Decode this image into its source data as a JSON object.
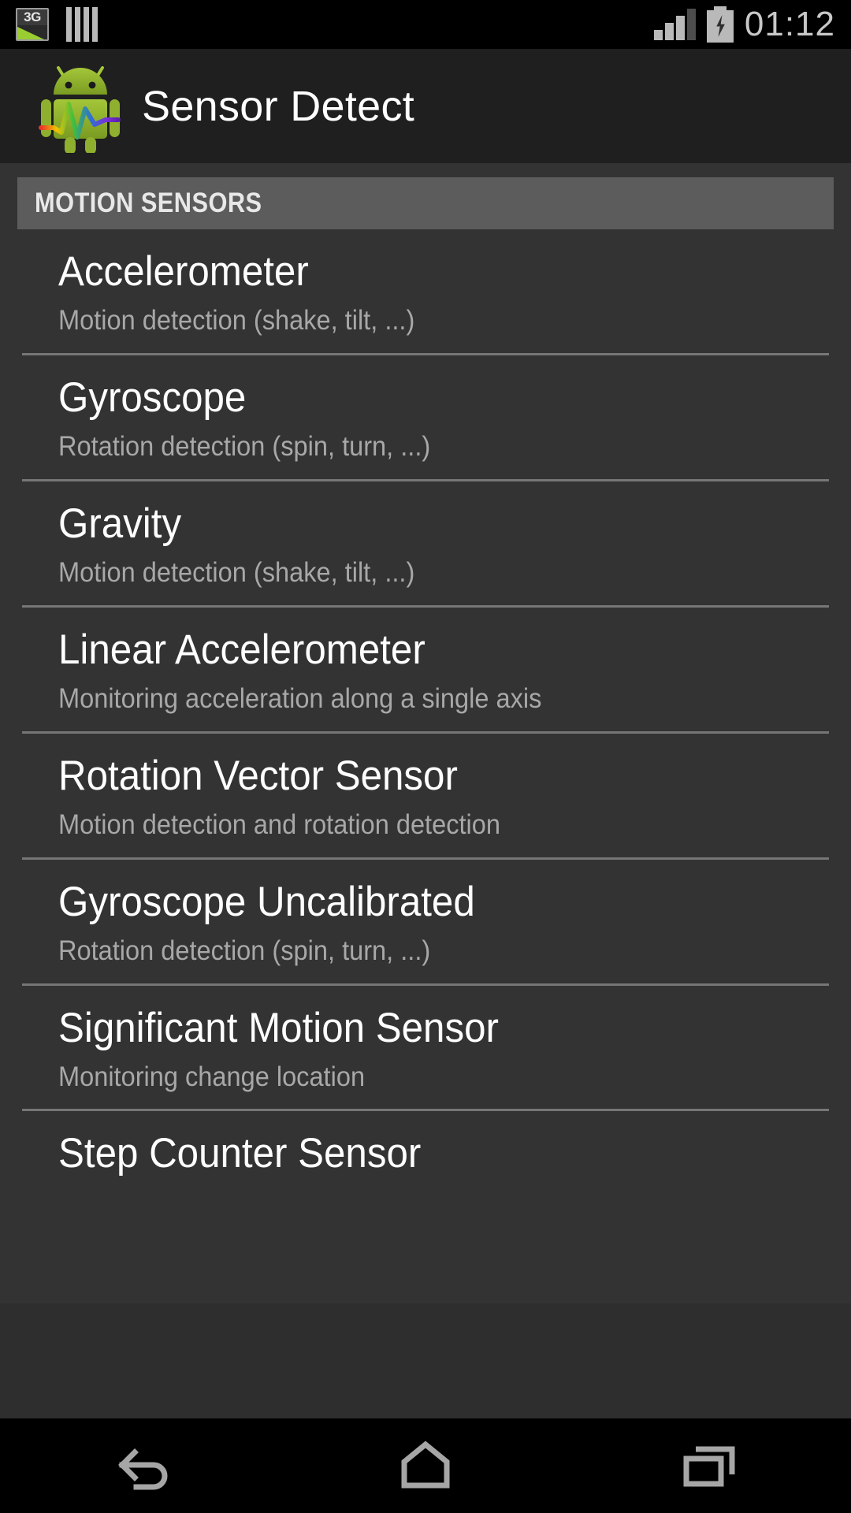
{
  "status_bar": {
    "network_label": "3G",
    "clock": "01:12",
    "icons": [
      "3g-data-icon",
      "sim-bars-icon",
      "signal-strength-icon",
      "battery-charging-icon"
    ]
  },
  "app_bar": {
    "title": "Sensor Detect",
    "logo": "android-robot-waveform-icon"
  },
  "section": {
    "header": "MOTION SENSORS"
  },
  "sensors": [
    {
      "title": "Accelerometer",
      "subtitle": "Motion detection (shake, tilt, ...)"
    },
    {
      "title": "Gyroscope",
      "subtitle": "Rotation detection (spin, turn, ...)"
    },
    {
      "title": "Gravity",
      "subtitle": "Motion detection (shake, tilt, ...)"
    },
    {
      "title": "Linear Accelerometer",
      "subtitle": "Monitoring acceleration along a single axis"
    },
    {
      "title": "Rotation Vector Sensor",
      "subtitle": "Motion detection and rotation detection"
    },
    {
      "title": "Gyroscope Uncalibrated",
      "subtitle": "Rotation detection (spin, turn, ...)"
    },
    {
      "title": "Significant Motion Sensor",
      "subtitle": "Monitoring change location"
    },
    {
      "title": "Step Counter Sensor",
      "subtitle": ""
    }
  ],
  "nav_bar": {
    "back": "back-icon",
    "home": "home-icon",
    "recents": "recent-apps-icon"
  },
  "colors": {
    "status_bar_bg": "#000000",
    "app_bar_bg": "#1f1f1f",
    "list_bg": "#333333",
    "section_header_bg": "#5c5c5c",
    "title_text": "#ffffff",
    "subtitle_text": "#a8a8a8",
    "divider": "#8d8d8d",
    "accent_green": "#9acd32"
  }
}
